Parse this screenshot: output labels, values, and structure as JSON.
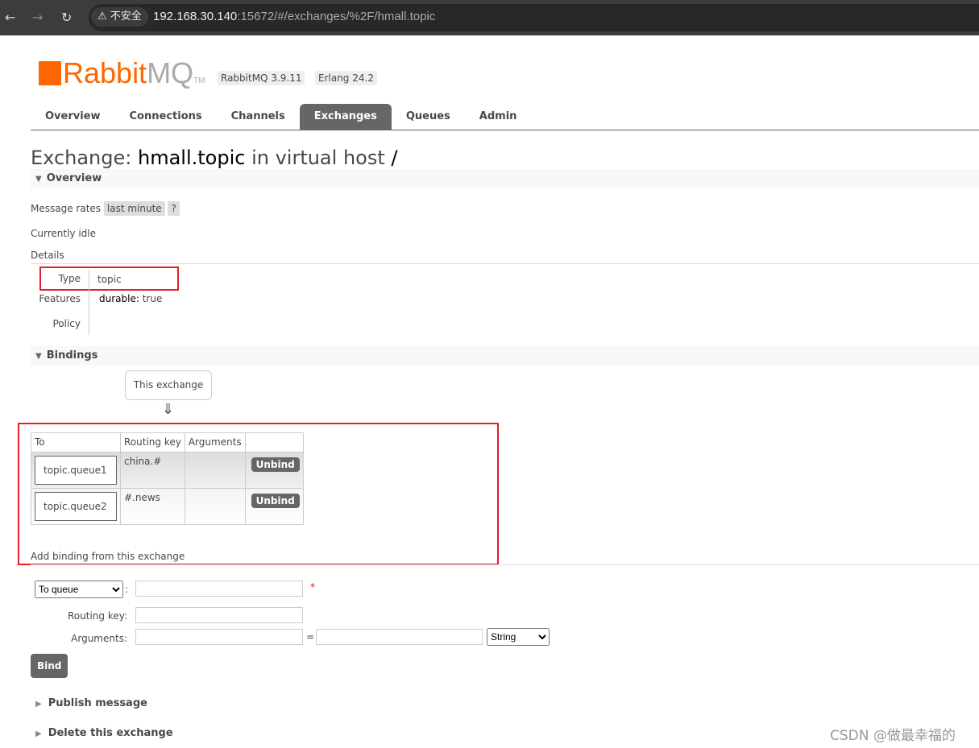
{
  "browser": {
    "security": "不安全",
    "url_host": "192.168.30.140",
    "url_rest": ":15672/#/exchanges/%2F/hmall.topic"
  },
  "header": {
    "logo_a": "Rabbit",
    "logo_b": "MQ",
    "tm": "TM",
    "version": "RabbitMQ 3.9.11",
    "erlang": "Erlang 24.2"
  },
  "tabs": [
    "Overview",
    "Connections",
    "Channels",
    "Exchanges",
    "Queues",
    "Admin"
  ],
  "title": {
    "prefix": "Exchange: ",
    "name": "hmall.topic",
    "mid": " in virtual host ",
    "vhost": "/"
  },
  "overview": {
    "heading": "Overview",
    "rates_label": "Message rates",
    "rates_value": "last minute",
    "help": "?",
    "idle": "Currently idle",
    "details": "Details",
    "type_label": "Type",
    "type_value": "topic",
    "features_label": "Features",
    "durable_label": "durable:",
    "durable_value": "true",
    "policy_label": "Policy"
  },
  "bindings": {
    "heading": "Bindings",
    "this_exchange": "This exchange",
    "arrow": "⇓",
    "headers": [
      "To",
      "Routing key",
      "Arguments",
      ""
    ],
    "rows": [
      {
        "to": "topic.queue1",
        "key": "china.#",
        "args": "",
        "action": "Unbind"
      },
      {
        "to": "topic.queue2",
        "key": "#.news",
        "args": "",
        "action": "Unbind"
      }
    ],
    "add_title": "Add binding from this exchange"
  },
  "form": {
    "dest_type": "To queue",
    "required": "*",
    "routing_label": "Routing key:",
    "args_label": "Arguments:",
    "eq": "=",
    "arg_type": "String",
    "bind": "Bind"
  },
  "sections": {
    "publish": "Publish message",
    "delete": "Delete this exchange"
  },
  "watermark": "CSDN @做最幸福的"
}
